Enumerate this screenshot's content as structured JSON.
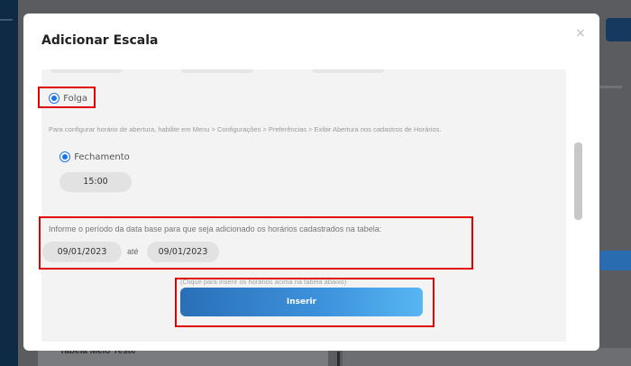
{
  "background": {
    "under_text": "Tabela Meio Teste"
  },
  "modal": {
    "title": "Adicionar Escala",
    "close_glyph": "×",
    "folga": {
      "label": "Folga",
      "selected": true
    },
    "hint": "Para configurar horário de abertura, habilite em Menu > Configurações > Preferências > Exibir Abertura nos cadastros de Horários.",
    "fechamento": {
      "label": "Fechamento",
      "selected": true,
      "time": "15:00"
    },
    "period": {
      "label": "Informe o período da data base para que seja adicionado os horários cadastrados na tabela:",
      "start_date": "09/01/2023",
      "separator": "até",
      "end_date": "09/01/2023"
    },
    "insert": {
      "hint": "(Clique para inserir os horários acima na tabela abaixo)",
      "button_label": "Inserir"
    }
  },
  "colors": {
    "accent": "#1a73e8",
    "highlight_border": "#e00000",
    "button_gradient_start": "#2a6fb8",
    "button_gradient_end": "#58b6f3"
  },
  "icons": {
    "close": "close-icon",
    "radio": "radio-selected-icon"
  }
}
